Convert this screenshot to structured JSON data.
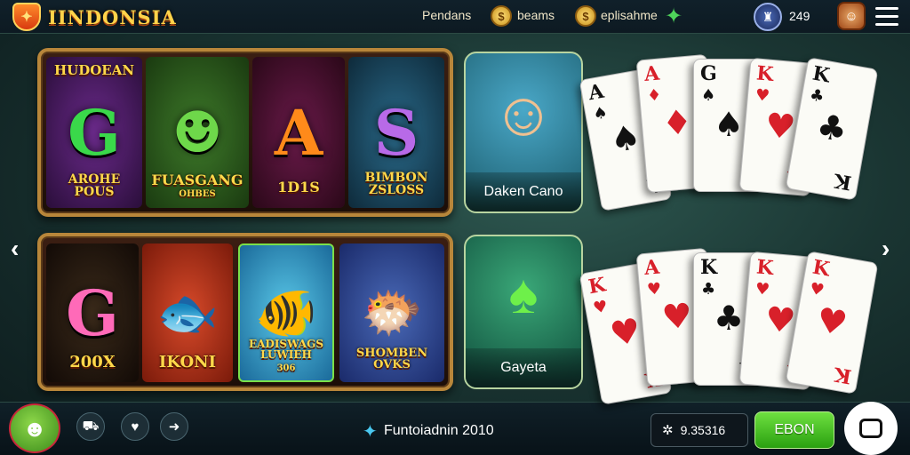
{
  "header": {
    "brand": "IINDONSIA",
    "logo_glyph": "✦",
    "links": [
      "Pendans",
      "beams",
      "eplisahme"
    ],
    "coin_icon": "$",
    "wallet_icon": "♜",
    "avatar_icon": "☺",
    "balance": "249"
  },
  "slots_panel_top": {
    "tiles": [
      {
        "top": "HUDOEAN",
        "big": "G",
        "bottom": "AROHE POUS"
      },
      {
        "top": "",
        "big": "☻",
        "bottom": "FUASGANG",
        "sub": "OHBES"
      },
      {
        "top": "",
        "big": "A",
        "bottom": "1D1S"
      },
      {
        "top": "",
        "big": "S",
        "bottom": "BIMBON ZSLOSS"
      }
    ]
  },
  "slots_panel_bottom": {
    "tiles": [
      {
        "big": "G",
        "bottom": "200X"
      },
      {
        "big": "🐟",
        "bottom": "IKONI"
      },
      {
        "big": "🐠",
        "bottom": "EADISWAGS LUWIEH",
        "sub": "306"
      },
      {
        "big": "🐡",
        "bottom": "SHOMBEN OVKS"
      }
    ]
  },
  "live_games": [
    {
      "name": "Daken Cano",
      "icon": "☺"
    },
    {
      "name": "Gayeta",
      "icon": "♠"
    }
  ],
  "cards_top": [
    {
      "rank": "A",
      "suit": "♠",
      "color": "black"
    },
    {
      "rank": "A",
      "suit": "♦",
      "color": "red"
    },
    {
      "rank": "G",
      "suit": "♠",
      "color": "black"
    },
    {
      "rank": "K",
      "suit": "♥",
      "color": "red"
    },
    {
      "rank": "K",
      "suit": "♣",
      "color": "black"
    }
  ],
  "cards_bottom": [
    {
      "rank": "K",
      "suit": "♥",
      "color": "red"
    },
    {
      "rank": "A",
      "suit": "♥",
      "color": "red"
    },
    {
      "rank": "K",
      "suit": "♣",
      "color": "black"
    },
    {
      "rank": "K",
      "suit": "♥",
      "color": "red"
    },
    {
      "rank": "K",
      "suit": "♥",
      "color": "red"
    }
  ],
  "nav": {
    "prev": "‹",
    "next": "›"
  },
  "footer": {
    "mascot_icon": "☻",
    "btn_icons": [
      "⛟",
      "♥",
      "➜"
    ],
    "promo_icon": "✦",
    "promo_text": "Funtoiadnin 2010",
    "bet_icon": "✲",
    "bet_value": "9.35316",
    "go_label": "EBON"
  },
  "colors": {
    "accent_gold": "#ffd34a",
    "frame": "#b8863a",
    "go_green": "#4ac828"
  }
}
